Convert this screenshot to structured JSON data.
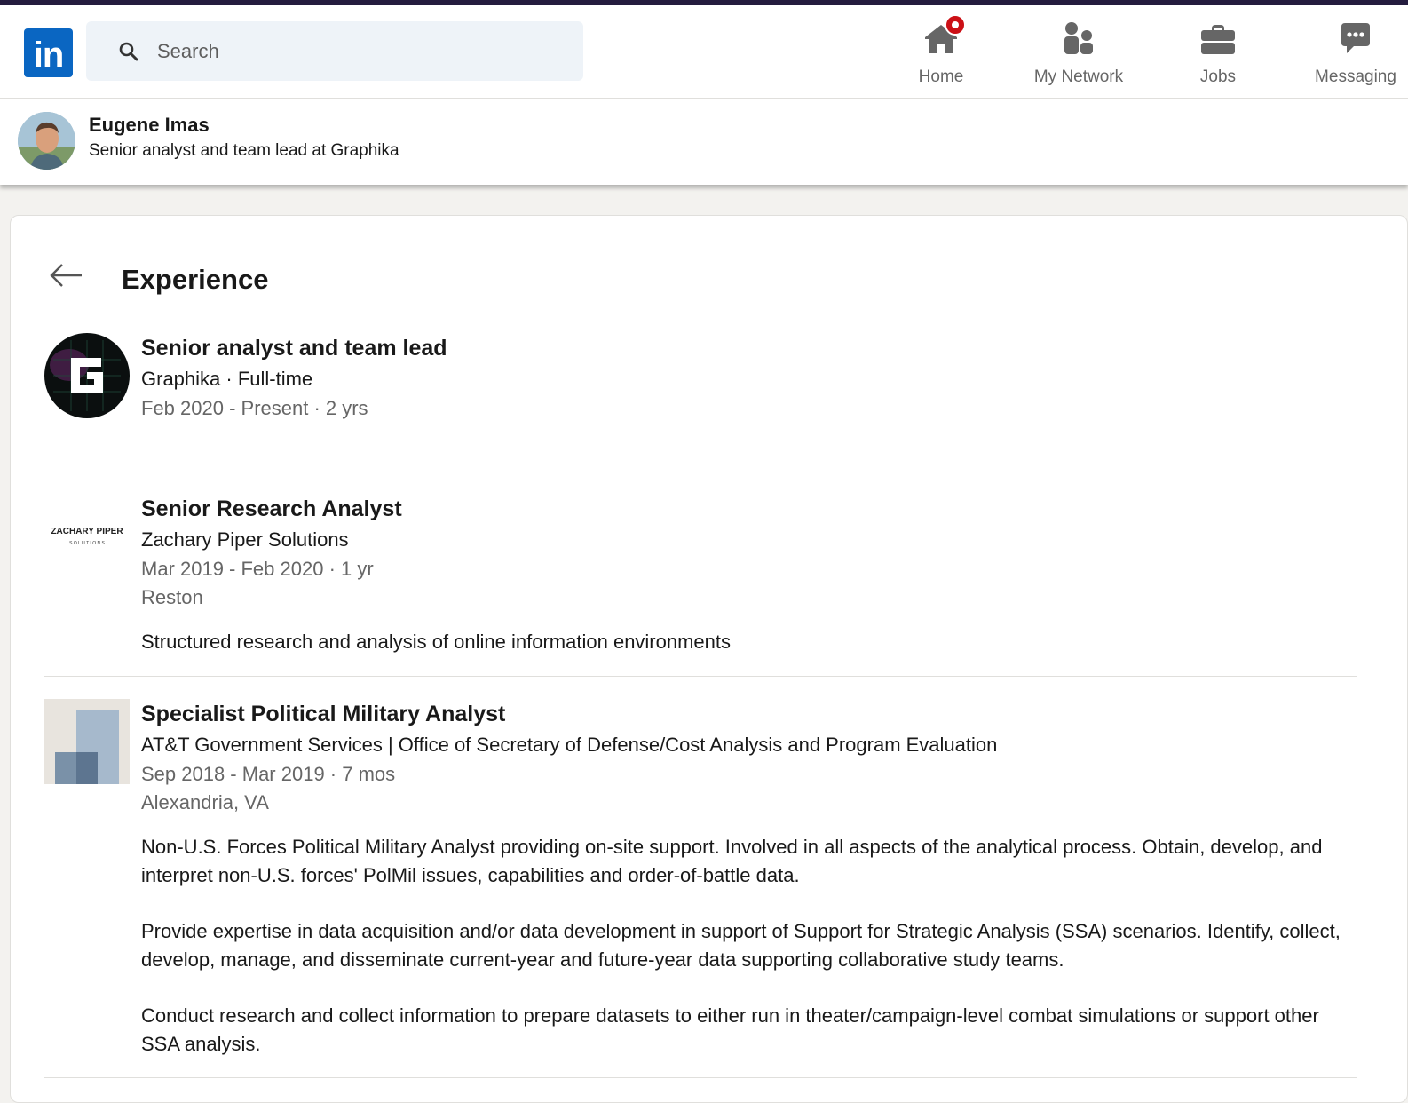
{
  "app": {
    "logo_text": "in",
    "brand_color": "#0a66c2"
  },
  "search": {
    "placeholder": "Search"
  },
  "nav": {
    "home": "Home",
    "network": "My Network",
    "jobs": "Jobs",
    "messaging": "Messaging",
    "home_badge_icon": "notification-dot"
  },
  "profile": {
    "name": "Eugene Imas",
    "headline": "Senior analyst and team lead at Graphika"
  },
  "section": {
    "title": "Experience"
  },
  "experience": [
    {
      "title": "Senior analyst and team lead",
      "company": "Graphika · Full-time",
      "dates": "Feb 2020 - Present · 2 yrs",
      "logo_icon": "graphika-logo"
    },
    {
      "title": "Senior Research Analyst",
      "company": "Zachary Piper Solutions",
      "dates": "Mar 2019 - Feb 2020 · 1 yr",
      "location": "Reston",
      "description": "Structured research and analysis of online information environments",
      "logo_text": "ZACHARY PIPER",
      "logo_subtext": "S O L U T I O N S"
    },
    {
      "title": "Specialist Political Military Analyst",
      "company": "AT&T Government Services | Office of Secretary of Defense/Cost Analysis and Program Evaluation",
      "dates": "Sep 2018 - Mar 2019 · 7 mos",
      "location": "Alexandria, VA",
      "description_p1": "Non-U.S. Forces Political Military Analyst providing on-site support. Involved in all aspects of the analytical process. Obtain, develop, and interpret non-U.S. forces' PolMil issues, capabilities and order-of-battle data.",
      "description_p2": "Provide expertise in data acquisition and/or data development in support of Support for Strategic Analysis (SSA) scenarios. Identify, collect, develop, manage, and disseminate current-year and future-year data supporting collaborative study teams.",
      "description_p3": "Conduct research and collect information to prepare datasets to either run in theater/campaign-level combat simulations or support other SSA analysis.",
      "logo_icon": "placeholder-company-logo"
    }
  ]
}
